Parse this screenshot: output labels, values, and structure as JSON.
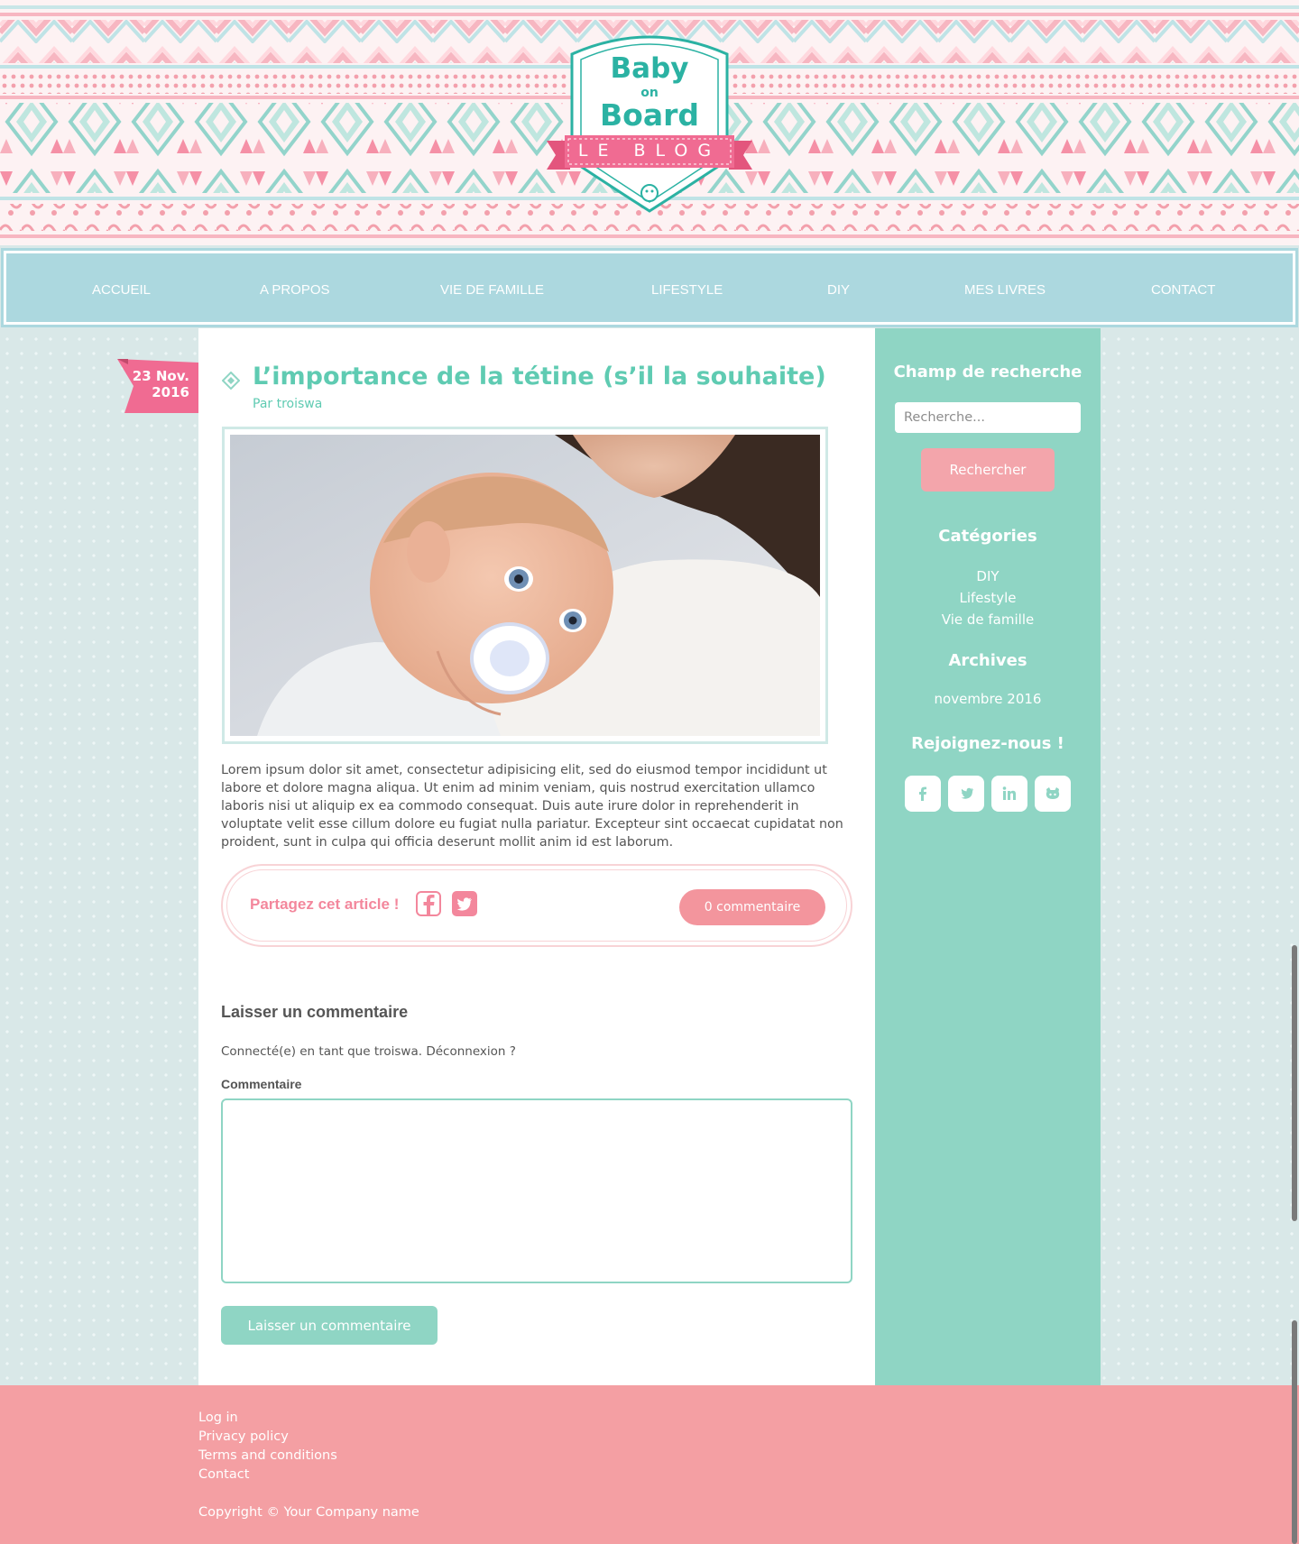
{
  "logo": {
    "line1": "Baby",
    "line2": "on",
    "line3": "Board",
    "ribbon": "LE BLOG"
  },
  "nav": {
    "items": [
      {
        "label": "ACCUEIL"
      },
      {
        "label": "A PROPOS"
      },
      {
        "label": "VIE DE FAMILLE"
      },
      {
        "label": "LIFESTYLE"
      },
      {
        "label": "DIY"
      },
      {
        "label": "MES LIVRES"
      },
      {
        "label": "CONTACT"
      }
    ]
  },
  "post": {
    "date_day": "23 Nov.",
    "date_year": "2016",
    "title": "L’importance de la tétine (s’il la souhaite)",
    "author": "Par troiswa",
    "body": "Lorem ipsum dolor sit amet, consectetur adipisicing elit, sed do eiusmod tempor incididunt ut labore et dolore magna aliqua. Ut enim ad minim veniam, quis nostrud exercitation ullamco laboris nisi ut aliquip ex ea commodo consequat. Duis aute irure dolor in reprehenderit in voluptate velit esse cillum dolore eu fugiat nulla pariatur. Excepteur sint occaecat cupidatat non proident, sunt in culpa qui officia deserunt mollit anim id est laborum.",
    "share_label": "Partagez cet article !",
    "comment_count": "0 commentaire"
  },
  "comment_form": {
    "heading": "Laisser un commentaire",
    "logged_in": "Connecté(e) en tant que troiswa. Déconnexion ?",
    "field_label": "Commentaire",
    "textarea_value": "",
    "submit_label": "Laisser un commentaire"
  },
  "sidebar": {
    "search_heading": "Champ de recherche",
    "search_placeholder": "Recherche...",
    "search_button": "Rechercher",
    "categories_heading": "Catégories",
    "categories": [
      "DIY",
      "Lifestyle",
      "Vie de famille"
    ],
    "archives_heading": "Archives",
    "archives": [
      "novembre 2016"
    ],
    "social_heading": "Rejoignez-nous !",
    "social_icons": [
      "facebook-icon",
      "twitter-icon",
      "linkedin-icon",
      "github-icon"
    ]
  },
  "footer": {
    "links": [
      "Log in",
      "Privacy policy",
      "Terms and conditions",
      "Contact"
    ],
    "copyright": "Copyright © Your Company name"
  },
  "colors": {
    "teal": "#8fd5c4",
    "title_teal": "#5fcbb2",
    "nav_blue": "#acd8df",
    "pink": "#f49fa3",
    "accent_pink": "#ef6a8c"
  }
}
